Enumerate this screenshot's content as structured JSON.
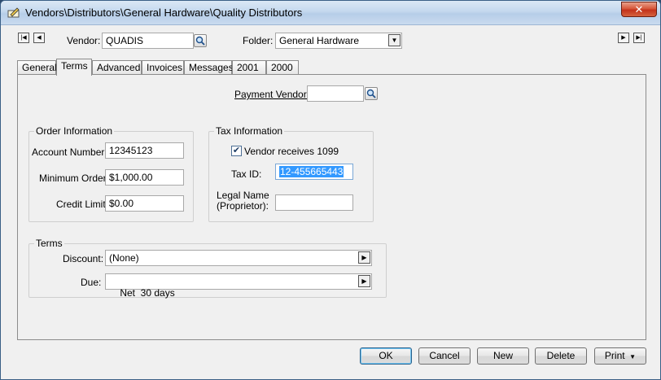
{
  "window": {
    "title": "Vendors\\Distributors\\General Hardware\\Quality Distributors",
    "close_icon": "close-icon"
  },
  "header": {
    "vendor_label": "Vendor:",
    "vendor_value": "QUADIS",
    "folder_label": "Folder:",
    "folder_value": "General Hardware"
  },
  "tabs": [
    {
      "label": "General"
    },
    {
      "label": "Terms"
    },
    {
      "label": "Advanced"
    },
    {
      "label": "Invoices"
    },
    {
      "label": "Messages"
    },
    {
      "label": "2001"
    },
    {
      "label": "2000"
    }
  ],
  "payment_vendor": {
    "label": "Payment Vendor:",
    "value": ""
  },
  "order_info": {
    "title": "Order Information",
    "account_number_label": "Account Number:",
    "account_number_value": "12345123",
    "minimum_order_label": "Minimum Order:",
    "minimum_order_value": "$1,000.00",
    "credit_limit_label": "Credit Limit",
    "credit_limit_value": "$0.00"
  },
  "tax_info": {
    "title": "Tax Information",
    "vendor_1099_label": "Vendor receives 1099",
    "vendor_1099_checked": true,
    "tax_id_label": "Tax ID:",
    "tax_id_value": "12-455665443",
    "legal_name_label_1": "Legal Name",
    "legal_name_label_2": "(Proprietor):",
    "legal_name_value": ""
  },
  "terms": {
    "title": "Terms",
    "discount_label": "Discount:",
    "discount_value": "(None)",
    "due_label": "Due:",
    "due_value": "Net  30 days"
  },
  "buttons": {
    "ok": "OK",
    "cancel": "Cancel",
    "new": "New",
    "delete": "Delete",
    "print": "Print"
  }
}
